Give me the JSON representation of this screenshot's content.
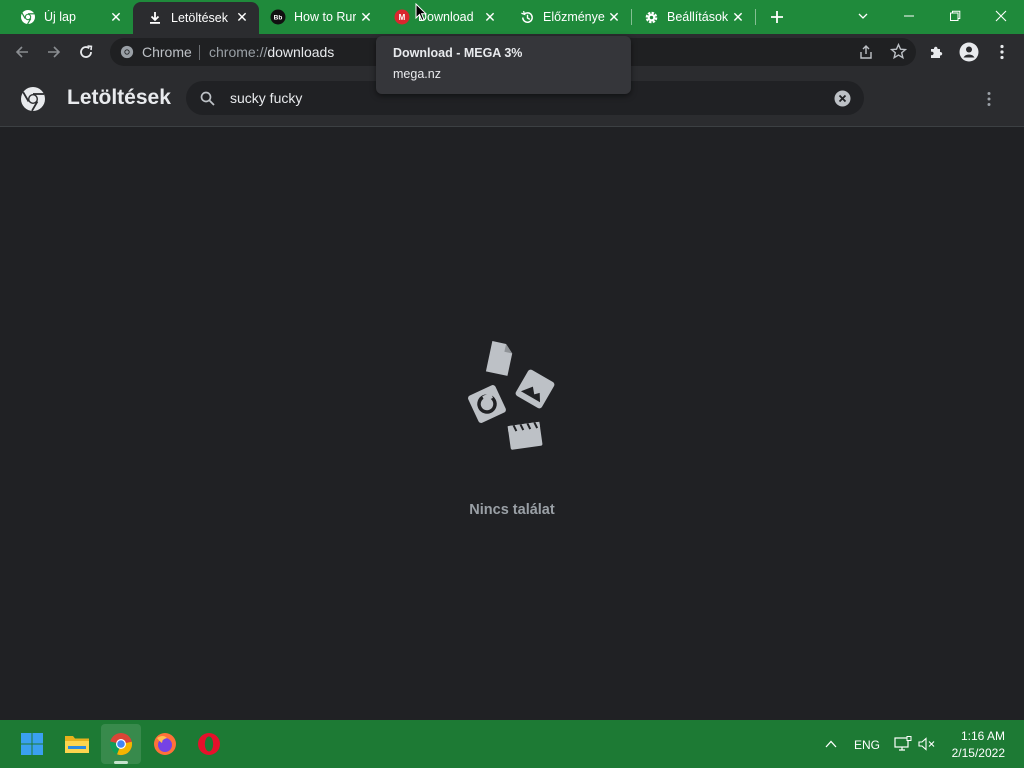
{
  "tabs": [
    {
      "label": "Új lap",
      "icon": "chrome-icon"
    },
    {
      "label": "Letöltések",
      "icon": "download-icon"
    },
    {
      "label": "How to Rur",
      "icon": "bb-icon"
    },
    {
      "label": "Download",
      "icon": "mega-icon"
    },
    {
      "label": "Előzmények",
      "icon": "history-icon"
    },
    {
      "label": "Beállítások",
      "icon": "gear-icon"
    }
  ],
  "omnibox": {
    "site_label": "Chrome",
    "url_scheme": "chrome://",
    "url_host": "downloads"
  },
  "downloads": {
    "title": "Letöltések",
    "search_value": "sucky fucky",
    "empty_message": "Nincs találat"
  },
  "tooltip": {
    "title": "Download - MEGA 3%",
    "subtitle": "mega.nz"
  },
  "taskbar": {
    "language": "ENG",
    "time": "1:16 AM",
    "date": "2/15/2022"
  },
  "colors": {
    "tabstrip": "#1f8a3b",
    "taskbar": "#1d7a34",
    "page_bg": "#202124",
    "toolbar": "#2b2c2f"
  }
}
